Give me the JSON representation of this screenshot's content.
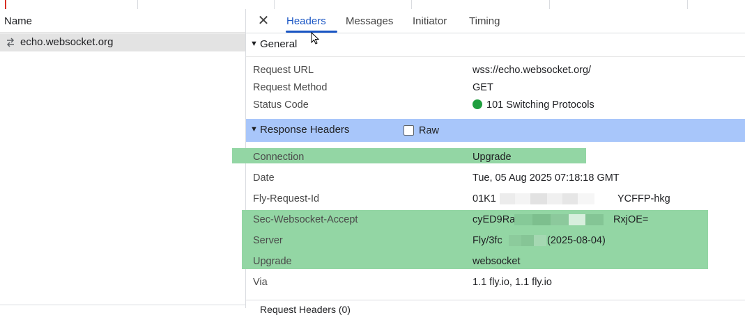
{
  "left_pane": {
    "column_header": "Name",
    "requests": [
      {
        "name": "echo.websocket.org",
        "icon": "websocket-arrows-icon"
      }
    ]
  },
  "tabs": {
    "close_icon": "close-icon",
    "items": [
      "Headers",
      "Messages",
      "Initiator",
      "Timing"
    ],
    "active": "Headers"
  },
  "general": {
    "title": "General",
    "rows": [
      {
        "key": "Request URL",
        "value": "wss://echo.websocket.org/"
      },
      {
        "key": "Request Method",
        "value": "GET"
      },
      {
        "key": "Status Code",
        "value": "101 Switching Protocols"
      }
    ],
    "status_color": "#1e9e3e"
  },
  "response_headers": {
    "title": "Response Headers",
    "raw_label": "Raw",
    "raw_checked": false,
    "rows": [
      {
        "key": "Connection",
        "value": "Upgrade"
      },
      {
        "key": "Date",
        "value": "Tue, 05 Aug 2025 07:18:18 GMT"
      },
      {
        "key": "Fly-Request-Id",
        "value": "01K1",
        "value_suffix": "YCFFP-hkg"
      },
      {
        "key": "Sec-Websocket-Accept",
        "value": "cyED9Ra",
        "value_suffix": "RxjOE="
      },
      {
        "key": "Server",
        "value": "Fly/3fc",
        "value_suffix": "(2025-08-04)"
      },
      {
        "key": "Upgrade",
        "value": "websocket"
      },
      {
        "key": "Via",
        "value": "1.1 fly.io, 1.1 fly.io"
      }
    ]
  },
  "next_section": {
    "title": "Request Headers (0)"
  },
  "colors": {
    "highlight_green": "#93d6a4",
    "section_selected": "#a8c6fa",
    "tab_active": "#1a56c4"
  }
}
